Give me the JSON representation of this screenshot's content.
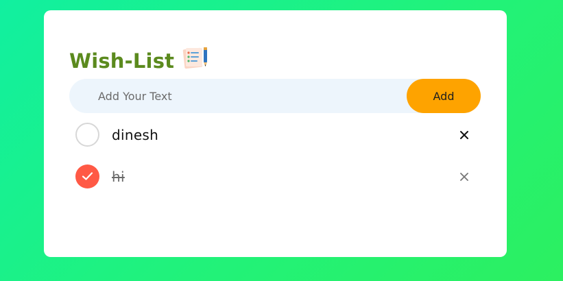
{
  "header": {
    "title": "Wish-List",
    "title_icon": "notepad-checklist-icon"
  },
  "input": {
    "placeholder": "Add Your Text",
    "value": ""
  },
  "add_button": {
    "label": "Add"
  },
  "tasks": [
    {
      "text": "dinesh",
      "checked": false,
      "remove_icon": "close-icon"
    },
    {
      "text": "hi",
      "checked": true,
      "remove_icon": "close-icon"
    }
  ],
  "colors": {
    "title": "#5b8a1e",
    "add_button": "#fea300",
    "checked": "#ff5945",
    "input_bg": "#edf5fc"
  }
}
